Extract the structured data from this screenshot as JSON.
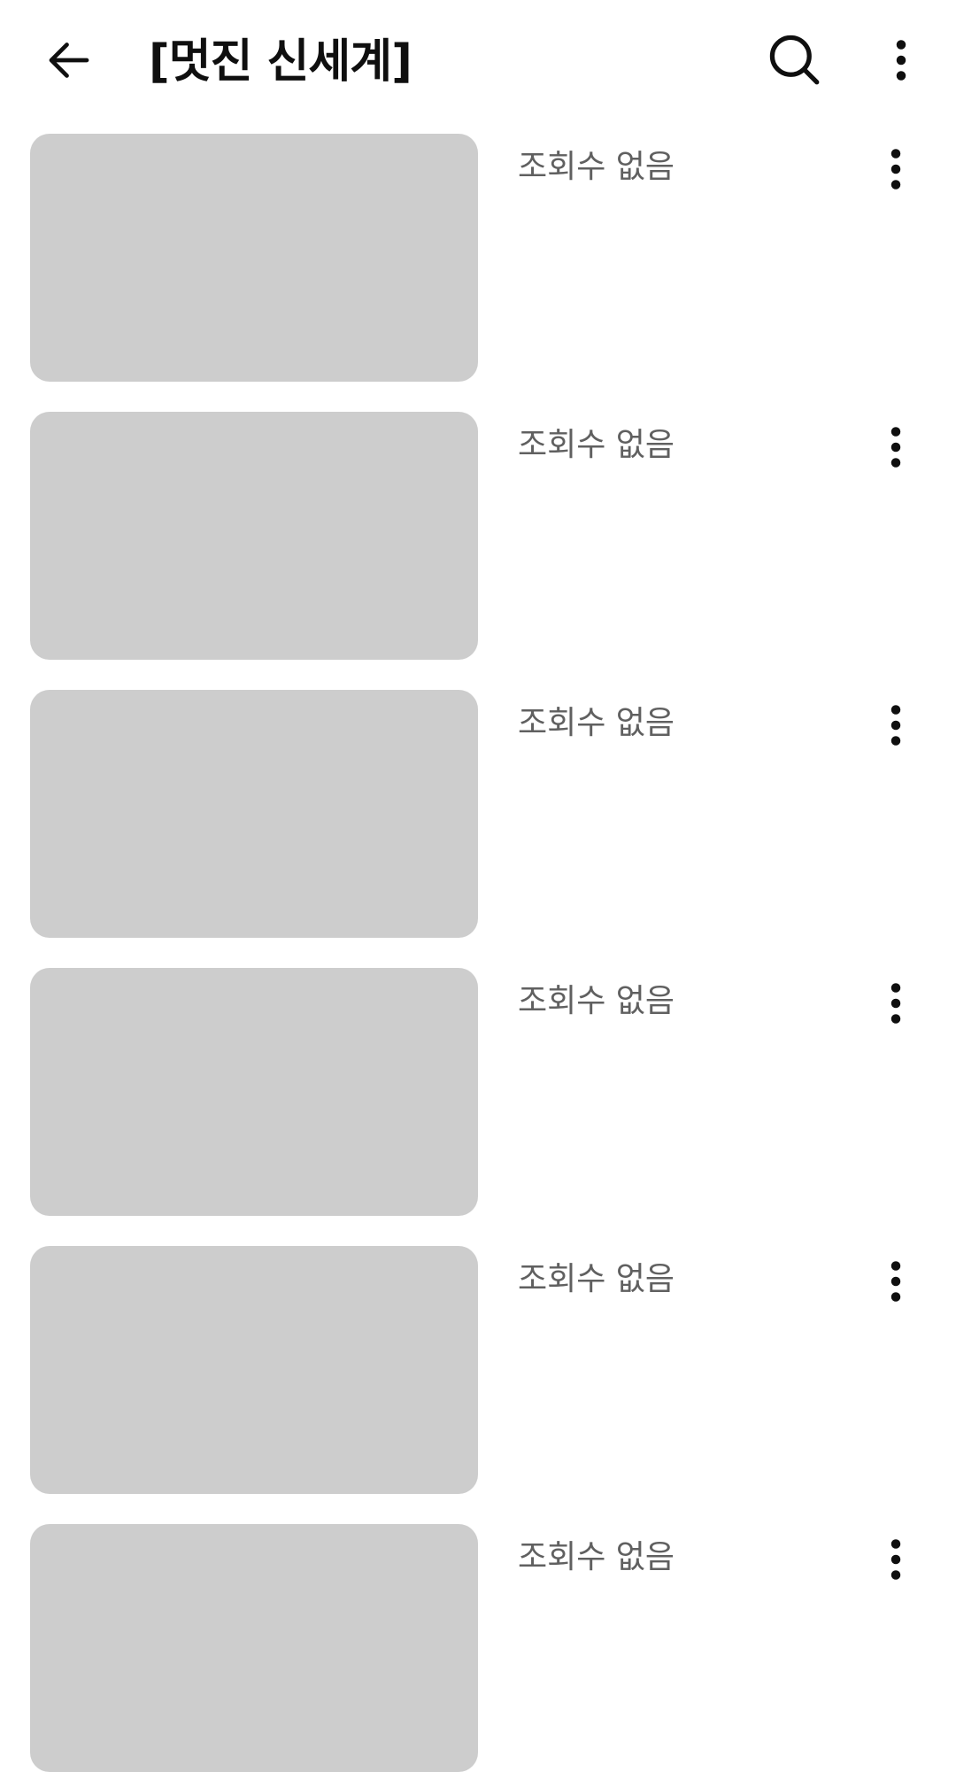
{
  "header": {
    "title": "[멋진 신세계]",
    "back_icon": "arrow-left-icon",
    "search_icon": "search-icon",
    "more_icon": "more-vert-icon"
  },
  "colors": {
    "background": "#ffffff",
    "thumbnail_placeholder": "#cdcdcd",
    "meta_text": "#606060",
    "icon": "#0f0f0f"
  },
  "videos": [
    {
      "meta": "조회수 없음",
      "menu_icon": "more-vert-icon"
    },
    {
      "meta": "조회수 없음",
      "menu_icon": "more-vert-icon"
    },
    {
      "meta": "조회수 없음",
      "menu_icon": "more-vert-icon"
    },
    {
      "meta": "조회수 없음",
      "menu_icon": "more-vert-icon"
    },
    {
      "meta": "조회수 없음",
      "menu_icon": "more-vert-icon"
    },
    {
      "meta": "조회수 없음",
      "menu_icon": "more-vert-icon"
    }
  ]
}
